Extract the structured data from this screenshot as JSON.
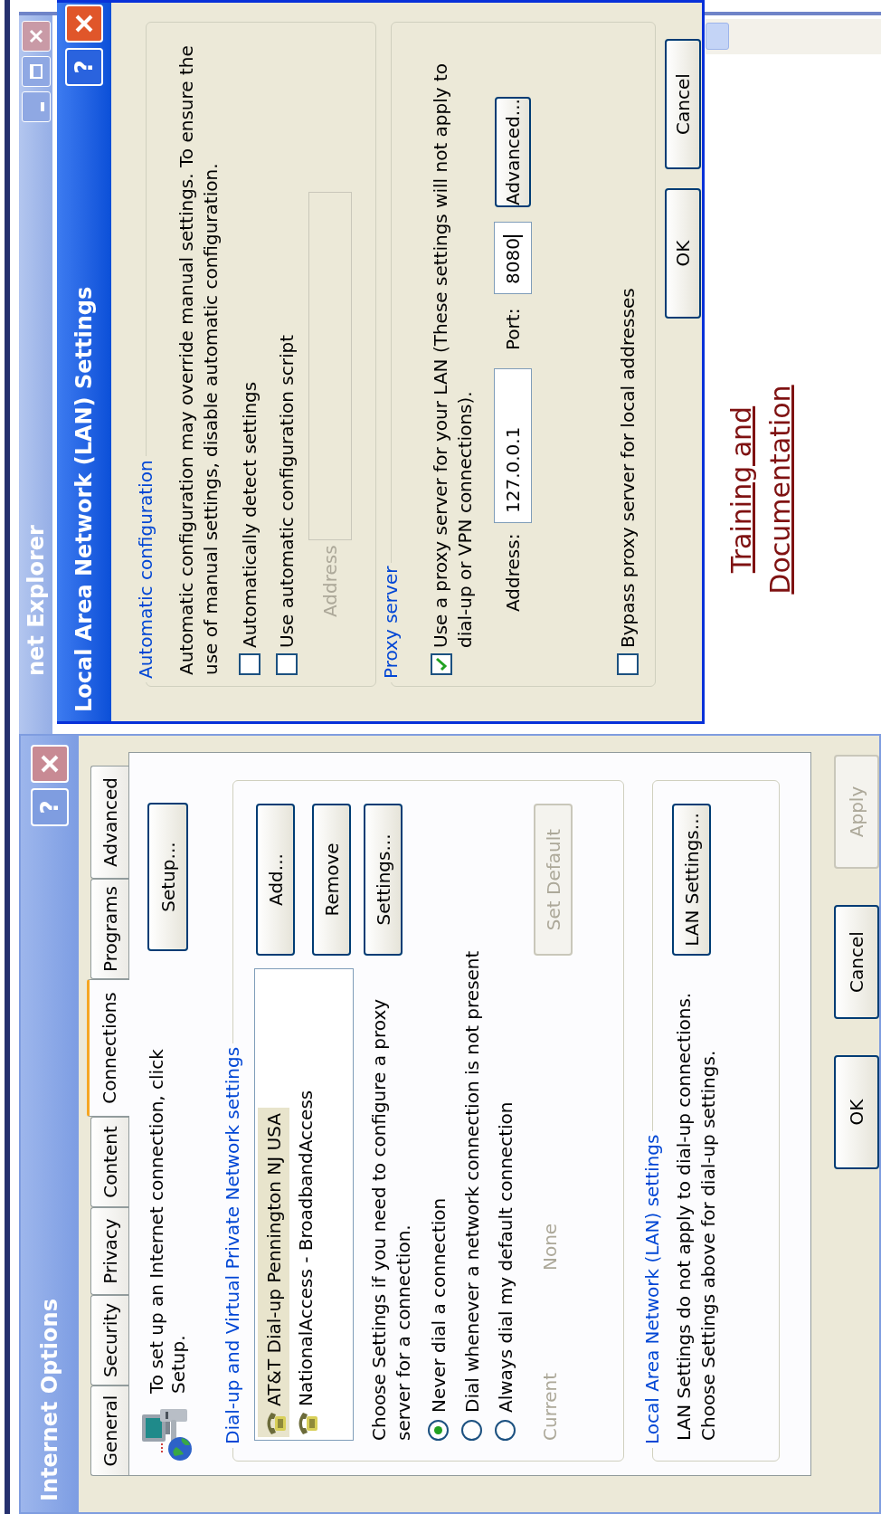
{
  "background_window": {
    "title": "net Explorer",
    "page_link_lines": [
      "Training and",
      "Documentation"
    ]
  },
  "internet_options": {
    "title": "Internet Options",
    "help_button": "?",
    "tabs": [
      {
        "label": "General",
        "selected": false
      },
      {
        "label": "Security",
        "selected": false
      },
      {
        "label": "Privacy",
        "selected": false
      },
      {
        "label": "Content",
        "selected": false
      },
      {
        "label": "Connections",
        "selected": true
      },
      {
        "label": "Programs",
        "selected": false
      },
      {
        "label": "Advanced",
        "selected": false
      }
    ],
    "setup": {
      "text": "To set up an Internet connection, click\nSetup.",
      "button": "Setup..."
    },
    "dialup_group": {
      "label": "Dial-up and Virtual Private Network settings",
      "connections": [
        {
          "name": "AT&T Dial-up Pennington NJ USA",
          "selected": true
        },
        {
          "name": "NationalAccess - BroadbandAccess",
          "selected": false
        }
      ],
      "buttons": [
        {
          "label": "Add...",
          "disabled": false
        },
        {
          "label": "Remove",
          "disabled": false
        },
        {
          "label": "Settings...",
          "disabled": false
        }
      ],
      "proxy_note": "Choose Settings if you need to configure a proxy\nserver for a connection.",
      "dial_options": [
        {
          "label": "Never dial a connection",
          "selected": true
        },
        {
          "label": "Dial whenever a network connection is not present",
          "selected": false
        },
        {
          "label": "Always dial my default connection",
          "selected": false
        }
      ],
      "current_label": "Current",
      "current_value": "None",
      "set_default": {
        "label": "Set Default",
        "disabled": true
      }
    },
    "lan_group": {
      "label": "Local Area Network (LAN) settings",
      "text": "LAN Settings do not apply to dial-up connections.\nChoose Settings above for dial-up settings.",
      "button": "LAN Settings..."
    },
    "buttons": [
      {
        "label": "OK",
        "disabled": false
      },
      {
        "label": "Cancel",
        "disabled": false
      },
      {
        "label": "Apply",
        "disabled": true
      }
    ]
  },
  "lan_dialog": {
    "title": "Local Area Network (LAN) Settings",
    "help_button": "?",
    "auto_group": {
      "label": "Automatic configuration",
      "text": "Automatic configuration may override manual settings.  To ensure the\nuse of manual settings, disable automatic configuration.",
      "options": [
        {
          "label": "Automatically detect settings",
          "checked": false
        },
        {
          "label": "Use automatic configuration script",
          "checked": false
        }
      ],
      "address_label": "Address",
      "address_disabled": true
    },
    "proxy_group": {
      "label": "Proxy server",
      "use_proxy": {
        "label": "Use a proxy server for your LAN (These settings will not apply to\ndial-up or VPN connections).",
        "checked": true
      },
      "address_label": "Address:",
      "address": "127.0.0.1",
      "port_label": "Port:",
      "port": "8080",
      "advanced_button": "Advanced...",
      "bypass": {
        "label": "Bypass proxy server for local addresses",
        "checked": false
      }
    },
    "buttons": [
      {
        "label": "OK"
      },
      {
        "label": "Cancel"
      }
    ]
  }
}
